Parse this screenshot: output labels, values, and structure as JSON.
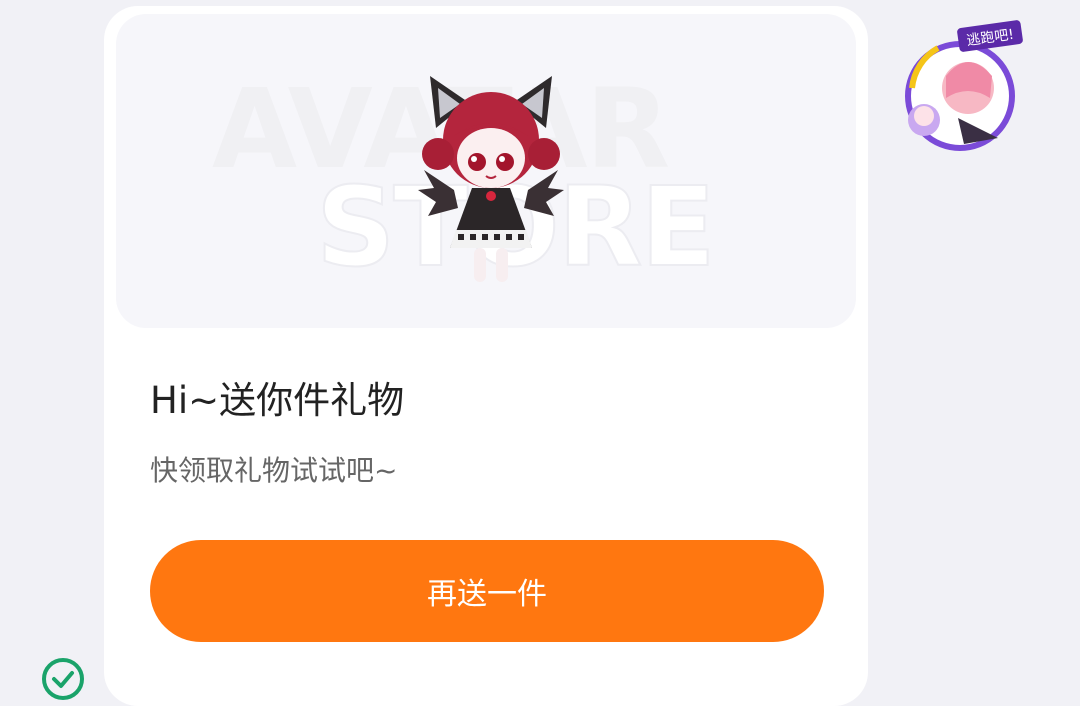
{
  "banner": {
    "watermark_line1": "AVATAR",
    "watermark_line2": "STORE",
    "image": "chibi-doll-cat-ears-bat-wings"
  },
  "gift": {
    "title": "Hi~送你件礼物",
    "subtitle": "快领取礼物试试吧~",
    "button_label": "再送一件"
  },
  "side_badge": {
    "image": "anime-character-sticker",
    "label": "逃跑吧!"
  },
  "colors": {
    "accent": "#ff7710",
    "card": "#ffffff",
    "page_bg": "#f1f1f6",
    "check": "#1aa36a"
  },
  "icons": {
    "status": "check-circle-icon"
  }
}
